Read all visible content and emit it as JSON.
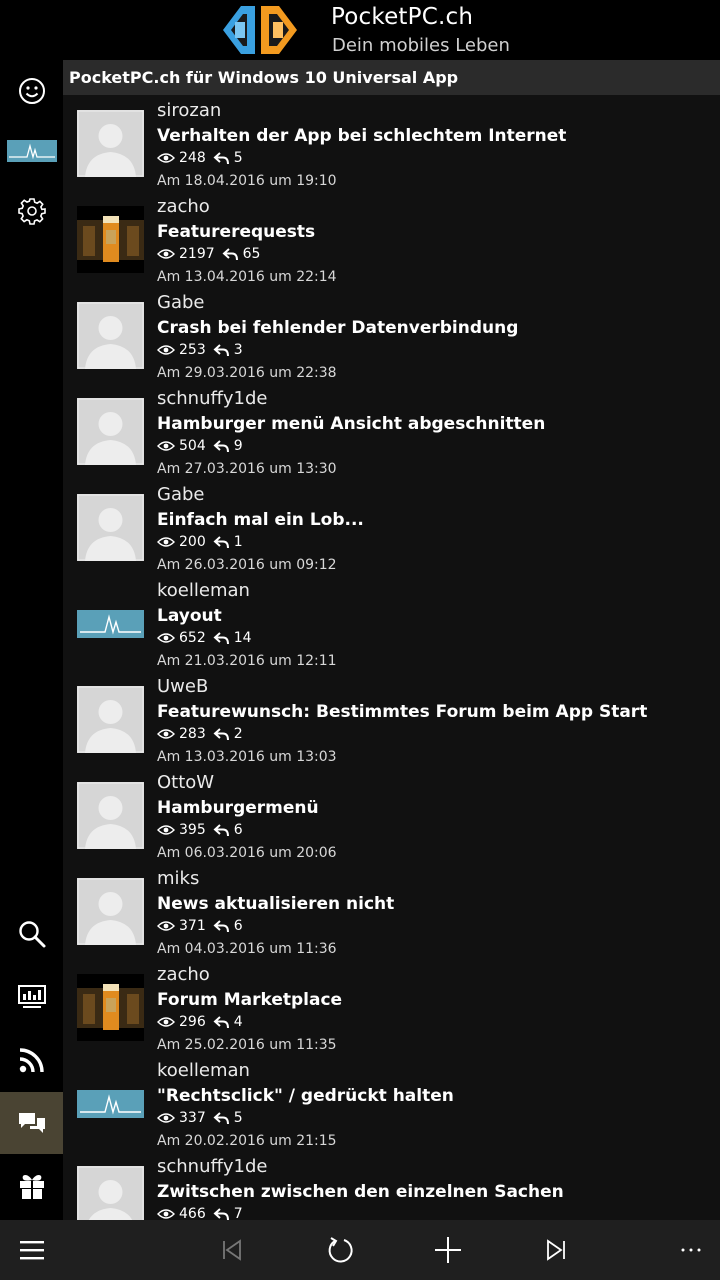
{
  "header": {
    "brand": "PocketPC.ch",
    "tagline": "Dein mobiles Leben",
    "colors": {
      "logo_blue": "#3aa0e0",
      "logo_orange": "#f39a1f"
    }
  },
  "sidebar": {
    "items": [
      {
        "icon": "smiley-icon"
      },
      {
        "icon": "signal-thumbnail-icon"
      },
      {
        "icon": "gear-icon"
      },
      {
        "icon": "search-icon"
      },
      {
        "icon": "presentation-icon"
      },
      {
        "icon": "rss-icon"
      },
      {
        "icon": "chat-bubbles-icon",
        "active": true
      },
      {
        "icon": "gift-icon"
      }
    ],
    "active_color": "#4a4433"
  },
  "forum": {
    "title": "PocketPC.ch für Windows 10 Universal App",
    "threads": [
      {
        "user": "sirozan",
        "title": "Verhalten der App bei schlechtem Internet",
        "views": "248",
        "replies": "5",
        "date": "Am 18.04.2016 um 19:10",
        "avatar": "default"
      },
      {
        "user": "zacho",
        "title": "Featurerequests",
        "views": "2197",
        "replies": "65",
        "date": "Am 13.04.2016 um 22:14",
        "avatar": "beer"
      },
      {
        "user": "Gabe",
        "title": "Crash bei fehlender Datenverbindung",
        "views": "253",
        "replies": "3",
        "date": "Am 29.03.2016 um 22:38",
        "avatar": "default"
      },
      {
        "user": "schnuffy1de",
        "title": "Hamburger menü Ansicht abgeschnitten",
        "views": "504",
        "replies": "9",
        "date": "Am 27.03.2016 um 13:30",
        "avatar": "default"
      },
      {
        "user": "Gabe",
        "title": "Einfach mal ein Lob...",
        "views": "200",
        "replies": "1",
        "date": "Am 26.03.2016 um 09:12",
        "avatar": "default"
      },
      {
        "user": "koelleman",
        "title": "Layout",
        "views": "652",
        "replies": "14",
        "date": "Am 21.03.2016 um 12:11",
        "avatar": "signal"
      },
      {
        "user": "UweB",
        "title": "Featurewunsch: Bestimmtes Forum beim App Start",
        "views": "283",
        "replies": "2",
        "date": "Am 13.03.2016 um 13:03",
        "avatar": "default"
      },
      {
        "user": "OttoW",
        "title": "Hamburgermenü",
        "views": "395",
        "replies": "6",
        "date": "Am 06.03.2016 um 20:06",
        "avatar": "default"
      },
      {
        "user": "miks",
        "title": "News aktualisieren nicht",
        "views": "371",
        "replies": "6",
        "date": "Am 04.03.2016 um 11:36",
        "avatar": "default"
      },
      {
        "user": "zacho",
        "title": "Forum Marketplace",
        "views": "296",
        "replies": "4",
        "date": "Am 25.02.2016 um 11:35",
        "avatar": "beer"
      },
      {
        "user": "koelleman",
        "title": "\"Rechtsclick\" / gedrückt halten",
        "views": "337",
        "replies": "5",
        "date": "Am 20.02.2016 um 21:15",
        "avatar": "signal"
      },
      {
        "user": "schnuffy1de",
        "title": "Zwitschen zwischen den einzelnen Sachen",
        "views": "466",
        "replies": "7",
        "date": "",
        "avatar": "default"
      }
    ]
  },
  "appbar": {
    "buttons": [
      {
        "icon": "hamburger-menu-icon",
        "enabled": true
      },
      {
        "icon": "first-page-icon",
        "enabled": false
      },
      {
        "icon": "refresh-icon",
        "enabled": true
      },
      {
        "icon": "add-icon",
        "enabled": true
      },
      {
        "icon": "last-page-icon",
        "enabled": true
      },
      {
        "icon": "more-icon",
        "enabled": true
      }
    ]
  }
}
